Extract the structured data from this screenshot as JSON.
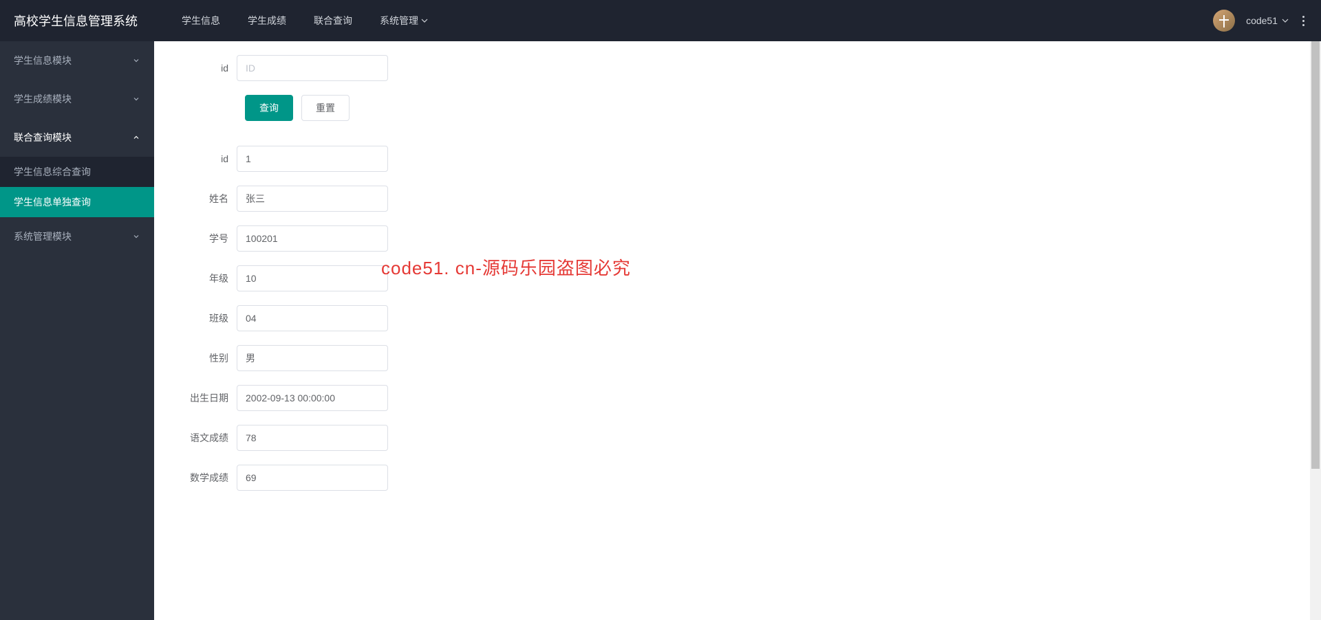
{
  "header": {
    "title": "高校学生信息管理系统",
    "nav": [
      "学生信息",
      "学生成绩",
      "联合查询",
      "系统管理"
    ],
    "username": "code51"
  },
  "sidebar": {
    "items": [
      {
        "label": "学生信息模块",
        "expanded": false
      },
      {
        "label": "学生成绩模块",
        "expanded": false
      },
      {
        "label": "联合查询模块",
        "expanded": true,
        "children": [
          {
            "label": "学生信息综合查询",
            "active": false
          },
          {
            "label": "学生信息单独查询",
            "active": true
          }
        ]
      },
      {
        "label": "系统管理模块",
        "expanded": false
      }
    ]
  },
  "search": {
    "id_label": "id",
    "id_placeholder": "ID",
    "query_btn": "查询",
    "reset_btn": "重置"
  },
  "detail": {
    "fields": [
      {
        "label": "id",
        "value": "1"
      },
      {
        "label": "姓名",
        "value": "张三"
      },
      {
        "label": "学号",
        "value": "100201"
      },
      {
        "label": "年级",
        "value": "10"
      },
      {
        "label": "班级",
        "value": "04"
      },
      {
        "label": "性别",
        "value": "男"
      },
      {
        "label": "出生日期",
        "value": "2002-09-13 00:00:00"
      },
      {
        "label": "语文成绩",
        "value": "78"
      },
      {
        "label": "数学成绩",
        "value": "69"
      }
    ]
  },
  "watermark": "code51. cn-源码乐园盗图必究"
}
